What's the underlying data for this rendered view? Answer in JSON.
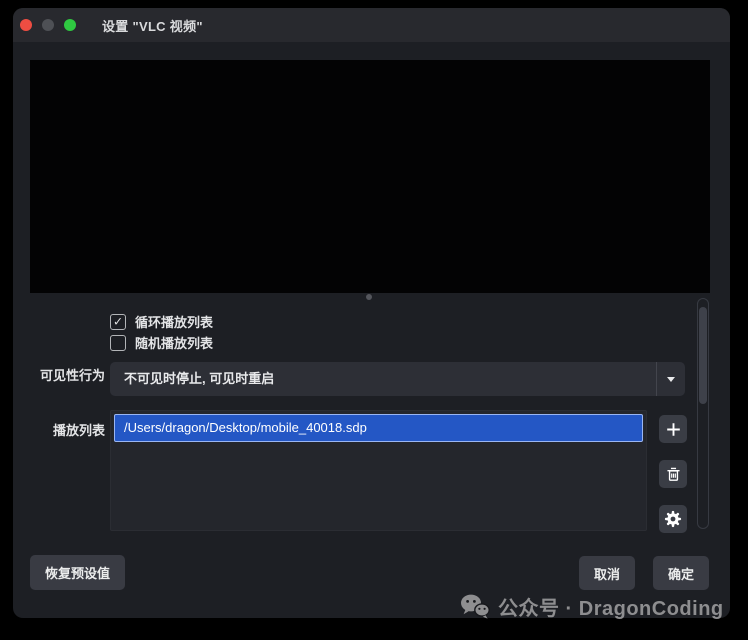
{
  "window": {
    "title": "设置 \"VLC 视频\"",
    "traffic_lights": [
      {
        "name": "close",
        "color": "#ee4d42"
      },
      {
        "name": "minimize",
        "color": "#4e5055"
      },
      {
        "name": "zoom",
        "color": "#2fc841"
      }
    ]
  },
  "checkboxes": [
    {
      "label": "循环播放列表",
      "checked": true
    },
    {
      "label": "随机播放列表",
      "checked": false
    }
  ],
  "visibility": {
    "label": "可见性行为",
    "value": "不可见时停止, 可见时重启"
  },
  "playlist": {
    "label": "播放列表",
    "items": [
      "/Users/dragon/Desktop/mobile_40018.sdp"
    ],
    "selected_index": 0,
    "buttons": [
      {
        "name": "add",
        "icon": "plus-icon"
      },
      {
        "name": "remove",
        "icon": "trash-icon"
      },
      {
        "name": "configure",
        "icon": "gear-icon"
      }
    ]
  },
  "footer": {
    "defaults_label": "恢复预设值",
    "cancel_label": "取消",
    "ok_label": "确定"
  },
  "watermark": {
    "icon": "wechat-icon",
    "text": "公众号 · DragonCoding",
    "color": "#8e8e90"
  },
  "colors": {
    "window_bg": "#1d1f24",
    "titlebar_bg": "#28292e",
    "control_bg": "#2d2f36",
    "list_bg": "#24262c",
    "selection": "#2457c5",
    "selection_border": "#9ab6f3",
    "button_bg": "#393b43"
  }
}
